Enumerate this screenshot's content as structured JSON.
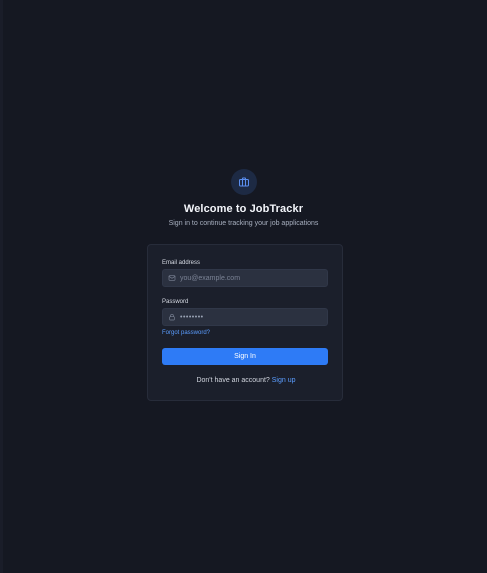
{
  "header": {
    "title": "Welcome to JobTrackr",
    "subtitle": "Sign in to continue tracking your job applications",
    "logo_icon": "briefcase-icon"
  },
  "form": {
    "email_label": "Email address",
    "email_placeholder": "you@example.com",
    "email_icon": "mail-icon",
    "password_label": "Password",
    "password_value": "••••••••",
    "password_icon": "lock-icon",
    "forgot_password": "Forgot password?",
    "sign_in_button": "Sign In",
    "signup_prompt": "Don't have an account?",
    "signup_link": "Sign up"
  },
  "colors": {
    "background": "#151822",
    "card": "#1b1f2b",
    "input": "#2b3140",
    "accent": "#2e7bf6",
    "link": "#5b9dff"
  }
}
